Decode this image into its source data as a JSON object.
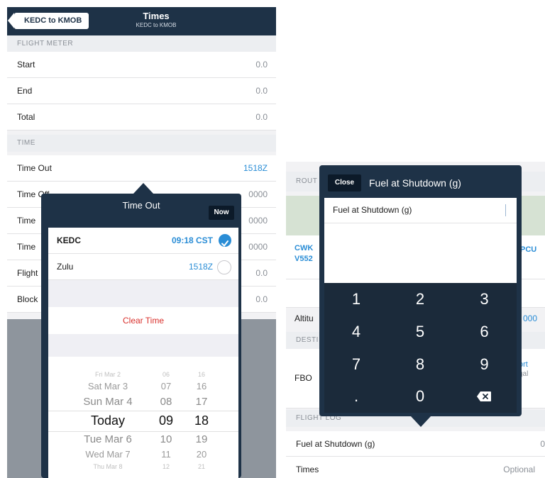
{
  "left": {
    "nav": {
      "back_label": "KEDC to KMOB",
      "title": "Times",
      "subtitle": "KEDC to KMOB"
    },
    "flight_meter": {
      "header": "FLIGHT METER",
      "rows": [
        {
          "label": "Start",
          "value": "0.0"
        },
        {
          "label": "End",
          "value": "0.0"
        },
        {
          "label": "Total",
          "value": "0.0"
        }
      ]
    },
    "time": {
      "header": "TIME",
      "rows": [
        {
          "label": "Time Out",
          "value": "1518Z"
        },
        {
          "label": "Time Off",
          "value": "0000"
        },
        {
          "label": "Time",
          "value": "0000"
        },
        {
          "label": "Time",
          "value": "0000"
        },
        {
          "label": "Flight",
          "value": "0.0"
        },
        {
          "label": "Block",
          "value": "0.0"
        }
      ]
    },
    "popover": {
      "title": "Time Out",
      "now_label": "Now",
      "options": [
        {
          "label": "KEDC",
          "value": "09:18 CST",
          "selected": true
        },
        {
          "label": "Zulu",
          "value": "1518Z",
          "selected": false
        }
      ],
      "clear_label": "Clear Time",
      "picker": {
        "days": [
          "Fri Mar 2",
          "Sat Mar 3",
          "Sun Mar 4",
          "Today",
          "Tue Mar 6",
          "Wed Mar 7",
          "Thu Mar 8"
        ],
        "hours": [
          "06",
          "07",
          "08",
          "09",
          "10",
          "11",
          "12"
        ],
        "minutes": [
          "16",
          "16",
          "17",
          "18",
          "19",
          "20",
          "21"
        ]
      }
    }
  },
  "right": {
    "behind": {
      "route_header": "ROUT",
      "route_left": "CWK",
      "route_left2": "V552",
      "route_right": "PCU",
      "altitude_label": "Altitu",
      "altitude_value": "000",
      "dest_header": "DESTI",
      "fbo_label": "FBO",
      "fbo_right1": "ort",
      "fbo_right2": "gal",
      "flight_log_header": "FLIGHT LOG",
      "rows": [
        {
          "label": "Fuel at Shutdown (g)",
          "value": "0"
        },
        {
          "label": "Times",
          "value": "Optional"
        }
      ]
    },
    "popover": {
      "close_label": "Close",
      "title": "Fuel at Shutdown (g)",
      "field_label": "Fuel at Shutdown (g)",
      "keys": [
        "1",
        "2",
        "3",
        "4",
        "5",
        "6",
        "7",
        "8",
        "9",
        ".",
        "0"
      ]
    }
  },
  "colors": {
    "nav_dark": "#1e3247",
    "accent_blue": "#2a8dd6",
    "destructive_red": "#d9302c"
  }
}
